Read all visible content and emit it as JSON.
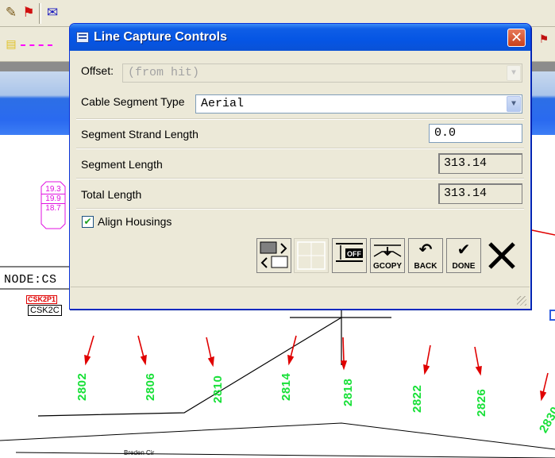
{
  "background": {
    "node_label": "NODE:CS",
    "csk_red": "CSK2P1",
    "csk_black": "CSK2C",
    "hex_values": [
      "19.3",
      "19.9",
      "18.7"
    ],
    "poles": [
      "2802",
      "2806",
      "2810",
      "2814",
      "2818",
      "2822",
      "2826",
      "2830"
    ],
    "street_label": "Breden Cir",
    "toolbar_icons": [
      "brush-icon",
      "flag-icon",
      "envelope-icon",
      "grid-icon",
      "star-icon",
      "sun-icon",
      "circle-icon",
      "box-icon",
      "text-a-icon",
      "text-t-icon",
      "hand-icon",
      "fence-icon",
      "frame-icon",
      "clock-icon",
      "globe-icon",
      "lock-icon",
      "dash-icon",
      "pin-icon",
      "person-icon"
    ]
  },
  "dialog": {
    "title": "Line Capture Controls",
    "offset": {
      "label": "Offset:",
      "value": "(from hit)"
    },
    "cable_type": {
      "label": "Cable Segment Type",
      "value": "Aerial"
    },
    "strand_length": {
      "label": "Segment Strand Length",
      "value": "0.0"
    },
    "segment_length": {
      "label": "Segment Length",
      "value": "313.14"
    },
    "total_length": {
      "label": "Total Length",
      "value": "313.14"
    },
    "align_housings": {
      "label": "Align Housings",
      "checked": true
    },
    "tools": {
      "off": "OFF",
      "gcopy": "GCOPY",
      "back": "BACK",
      "done": "DONE"
    }
  },
  "colors": {
    "title_blue": "#0555e4",
    "pole_green": "#18e038",
    "marker_red": "#e00000",
    "hex_magenta": "#e010e0"
  }
}
